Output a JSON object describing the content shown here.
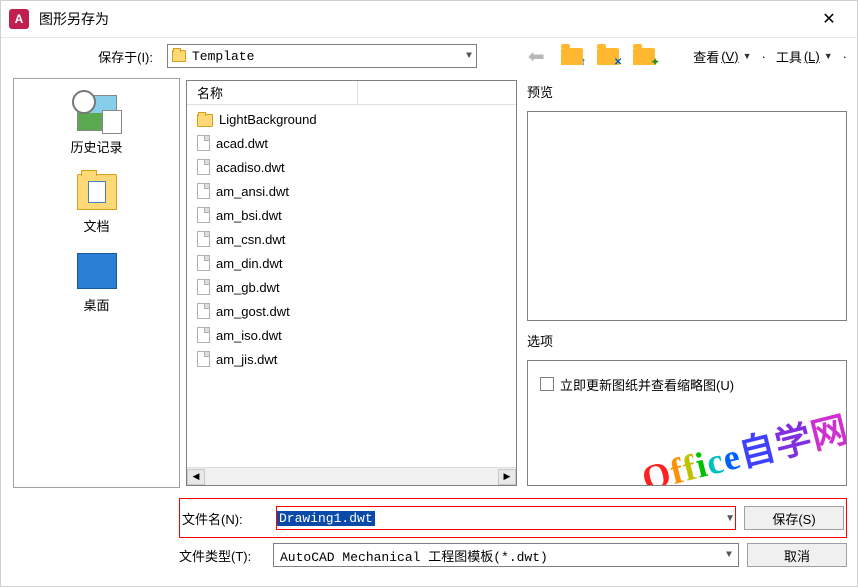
{
  "title": "图形另存为",
  "toolbar": {
    "save_in_label": "保存于(I):",
    "location": "Template",
    "view_label": "查看",
    "view_key": "(V)",
    "tools_label": "工具",
    "tools_key": "(L)"
  },
  "sidebar": {
    "items": [
      {
        "label": "历史记录"
      },
      {
        "label": "文档"
      },
      {
        "label": "桌面"
      }
    ]
  },
  "filelist": {
    "header": "名称",
    "items": [
      {
        "name": "LightBackground",
        "type": "folder"
      },
      {
        "name": "acad.dwt",
        "type": "file"
      },
      {
        "name": "acadiso.dwt",
        "type": "file"
      },
      {
        "name": "am_ansi.dwt",
        "type": "file"
      },
      {
        "name": "am_bsi.dwt",
        "type": "file"
      },
      {
        "name": "am_csn.dwt",
        "type": "file"
      },
      {
        "name": "am_din.dwt",
        "type": "file"
      },
      {
        "name": "am_gb.dwt",
        "type": "file"
      },
      {
        "name": "am_gost.dwt",
        "type": "file"
      },
      {
        "name": "am_iso.dwt",
        "type": "file"
      },
      {
        "name": "am_jis.dwt",
        "type": "file"
      }
    ]
  },
  "preview_label": "预览",
  "options": {
    "label": "选项",
    "checkbox_label": "立即更新图纸并查看缩略图(U)"
  },
  "watermark": "Office自学网",
  "form": {
    "filename_label": "文件名(N):",
    "filename_value": "Drawing1.dwt",
    "filetype_label": "文件类型(T):",
    "filetype_value": "AutoCAD Mechanical 工程图模板(*.dwt)",
    "save_button": "保存(S)",
    "cancel_button": "取消"
  }
}
